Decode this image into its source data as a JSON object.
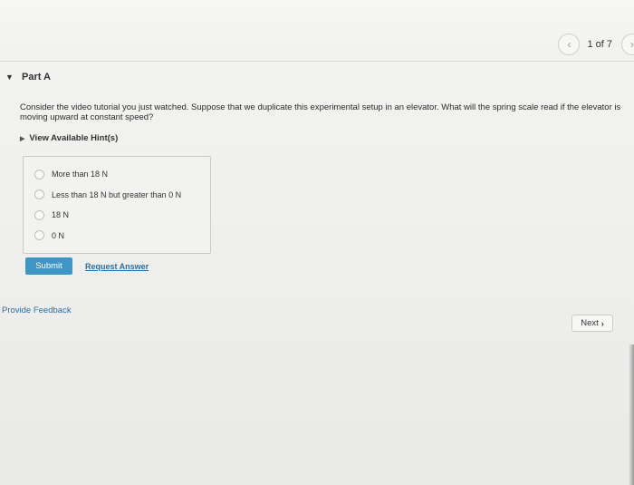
{
  "pager": {
    "prev_icon": "chevron-left-icon",
    "count_text": "1 of 7",
    "next_icon": "chevron-right-icon"
  },
  "part": {
    "title": "Part A"
  },
  "question": {
    "text": "Consider the video tutorial you just watched. Suppose that we duplicate this experimental setup in an elevator. What will the spring scale read if the elevator is moving upward at constant speed?"
  },
  "hints": {
    "label": "View Available Hint(s)"
  },
  "choices": [
    {
      "label": "More than 18 N",
      "selected": false
    },
    {
      "label": "Less than 18 N but greater than 0 N",
      "selected": false
    },
    {
      "label": "18 N",
      "selected": false
    },
    {
      "label": "0 N",
      "selected": false
    }
  ],
  "actions": {
    "submit_label": "Submit",
    "request_answer_label": "Request Answer"
  },
  "footer": {
    "feedback_label": "Provide Feedback",
    "next_label": "Next"
  },
  "colors": {
    "accent": "#3e96c4",
    "link": "#2a6fa3"
  }
}
